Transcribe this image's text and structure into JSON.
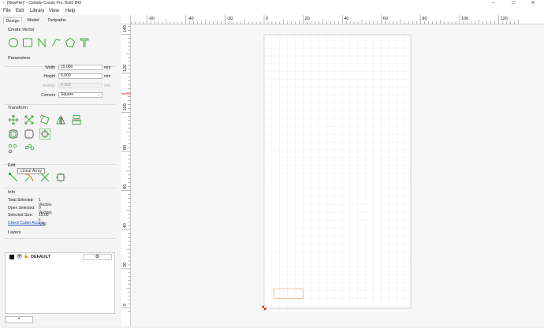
{
  "window": {
    "title": "[NewFile]* - Carbide Create Pro, Build 843",
    "minimize": "–",
    "maximize": "□",
    "close": "✕"
  },
  "menu": [
    "File",
    "Edit",
    "Library",
    "View",
    "Help"
  ],
  "tabs": [
    "Design",
    "Model",
    "Toolpaths"
  ],
  "create_vector": {
    "title": "Create Vector",
    "tools": [
      "circle-icon",
      "rectangle-icon",
      "polyline-icon",
      "curve-icon",
      "polygon-icon",
      "text-icon"
    ]
  },
  "parameters": {
    "title": "Parameters",
    "width_label": "Width",
    "width_value": "15.000",
    "height_label": "Height",
    "height_value": "5.000",
    "radius_label": "Radius",
    "radius_value": "6.350",
    "unit": "mm",
    "corners_label": "Corners",
    "corners_value": "Square"
  },
  "transform": {
    "title": "Transform",
    "tooltip": "Linear Array"
  },
  "edit": {
    "title": "Edit"
  },
  "info": {
    "title": "Info",
    "total_selected_label": "Total Selected:",
    "total_selected_value": "1 Vectors",
    "open_selected_label": "Open Selected:",
    "open_selected_value": "0 Vectors",
    "selected_size_label": "Selected Size:",
    "selected_size_value": "15.00 x 5.00",
    "check_link": "Check Cutter Access"
  },
  "layers": {
    "title": "Layers",
    "layer_name": "DEFAULT",
    "add_button": "+"
  },
  "ruler": {
    "x_ticks": [
      "-60",
      "-40",
      "-20",
      "0",
      "20",
      "40",
      "60",
      "80",
      "100",
      "120"
    ],
    "y_ticks": [
      "140",
      "120",
      "100",
      "80",
      "60",
      "40",
      "20",
      "0"
    ]
  },
  "colors": {
    "accent": "#3aa83a",
    "selection": "#f08c3c",
    "ruler_marker": "#e0261a",
    "link": "#1a4fc0"
  }
}
